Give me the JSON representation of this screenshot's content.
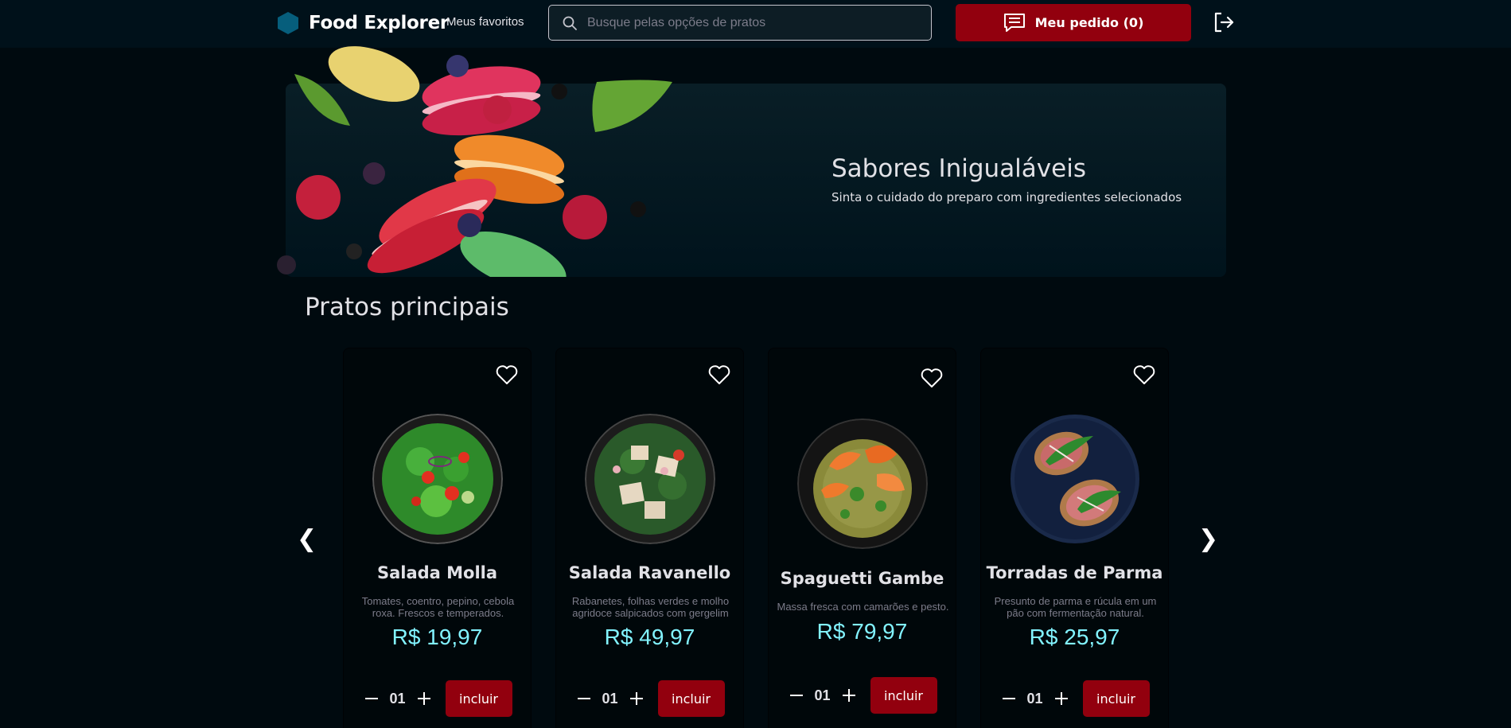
{
  "header": {
    "brand": "Food Explorer",
    "favorites_link": "Meus favoritos",
    "search_placeholder": "Busque pelas opções de pratos",
    "order_button": "Meu pedido (0)",
    "brand_color": "#065e7c",
    "accent_color": "#92000e"
  },
  "banner": {
    "title": "Sabores Inigualáveis",
    "subtitle": "Sinta o cuidado do preparo com ingredientes selecionados"
  },
  "section": {
    "title": "Pratos principais",
    "prev_icon": "❮",
    "next_icon": "❯"
  },
  "dishes": [
    {
      "name": "Salada Molla",
      "description": "Tomates, coentro, pepino, cebola roxa. Frescos e temperados.",
      "price": "R$ 19,97",
      "quantity": "01",
      "add_label": "incluir"
    },
    {
      "name": "Salada Ravanello",
      "description": "Rabanetes, folhas verdes e molho agridoce salpicados com gergelim",
      "price": "R$ 49,97",
      "quantity": "01",
      "add_label": "incluir"
    },
    {
      "name": "Spaguetti Gambe",
      "description": "Massa fresca com camarões e pesto.",
      "price": "R$ 79,97",
      "quantity": "01",
      "add_label": "incluir"
    },
    {
      "name": "Torradas de Parma",
      "description": "Presunto de parma e rúcula em um pão com fermentação natural.",
      "price": "R$ 25,97",
      "quantity": "01",
      "add_label": "incluir"
    }
  ]
}
